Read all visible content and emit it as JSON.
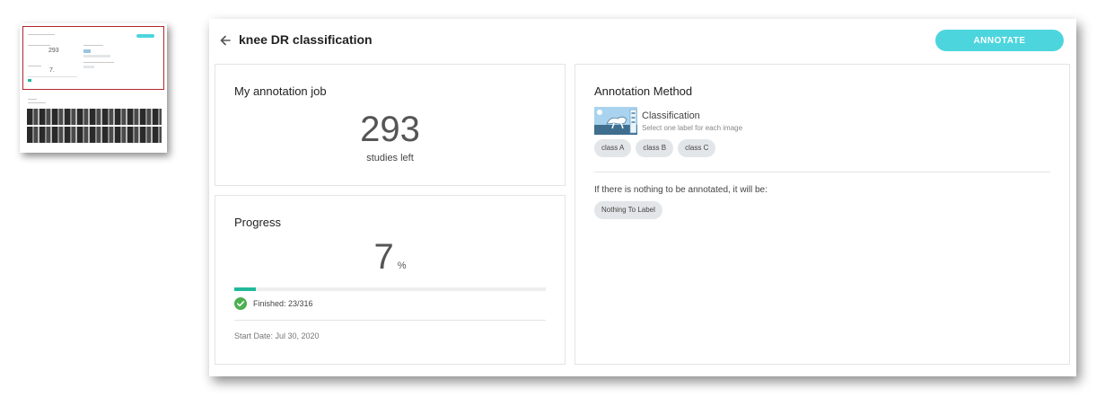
{
  "header": {
    "title": "knee DR classification",
    "annotate_label": "ANNOTATE"
  },
  "job_card": {
    "title": "My annotation job",
    "count": "293",
    "count_label": "studies left"
  },
  "progress_card": {
    "title": "Progress",
    "percent": "7",
    "percent_unit": "%",
    "progress_fraction": 0.07,
    "finished": "Finished: 23/316",
    "start_date": "Start Date: Jul 30, 2020"
  },
  "method_card": {
    "title": "Annotation Method",
    "method_name": "Classification",
    "method_desc": "Select one label for each image",
    "labels": [
      "class A",
      "class B",
      "class C"
    ],
    "nothing_text": "If there is nothing to be annotated, it will be:",
    "nothing_label": "Nothing To Label"
  },
  "colors": {
    "accent": "#4dd5de",
    "progress": "#21b89b",
    "success": "#4caf50",
    "chip_bg": "#e3e6e8"
  },
  "icons": {
    "back": "arrow-left-icon",
    "check": "check-circle-icon"
  }
}
